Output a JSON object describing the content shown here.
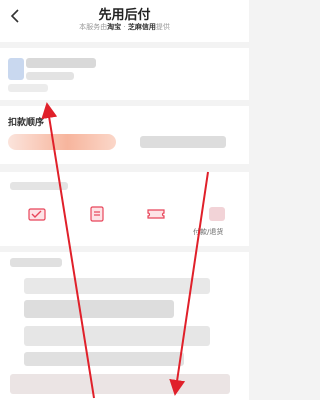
{
  "header": {
    "back_icon": "chevron-left-icon",
    "title": "先用后付",
    "subtitle_prefix": "本服务由",
    "subtitle_brand1": "淘宝",
    "subtitle_sep": " · ",
    "subtitle_brand2": "芝麻信用",
    "subtitle_suffix": "提供"
  },
  "limit": {
    "label": "扣款顺序"
  },
  "quick_actions": {
    "items": [
      {
        "icon": "checkmark-envelope-icon"
      },
      {
        "icon": "bill-icon"
      },
      {
        "icon": "ticket-icon"
      },
      {
        "label": "付款/退货"
      }
    ]
  },
  "colors": {
    "accent": "#e8455a",
    "annotation_arrow": "#e0202a"
  }
}
